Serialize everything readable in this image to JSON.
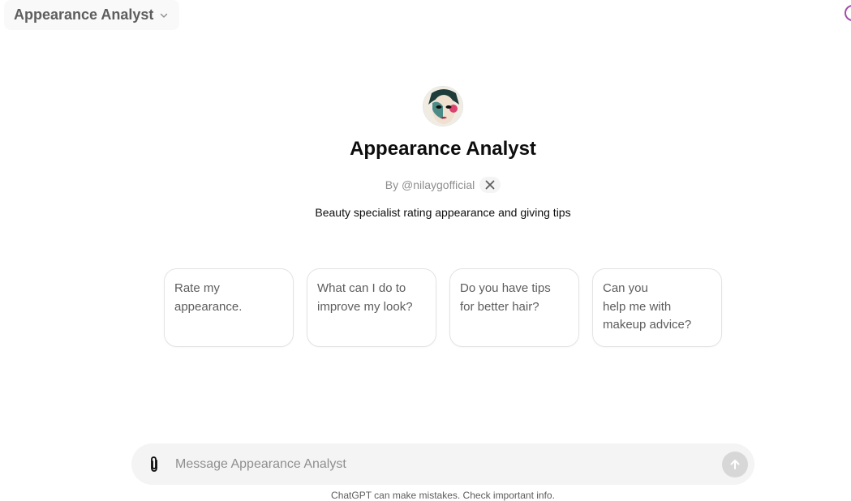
{
  "header": {
    "model_label": "Appearance Analyst",
    "chevron_icon": "chevron-down-icon"
  },
  "gpt": {
    "title": "Appearance Analyst",
    "author": "By @nilaygofficial",
    "social_icon": "x-logo-icon",
    "description": "Beauty specialist rating appearance and giving tips"
  },
  "starters": [
    {
      "lines": [
        "Rate my",
        "appearance."
      ]
    },
    {
      "lines": [
        "What can I do to",
        "improve my look?"
      ]
    },
    {
      "lines": [
        "Do you have tips",
        "for better hair?"
      ]
    },
    {
      "lines": [
        "Can you",
        "help me with",
        "makeup advice?"
      ]
    }
  ],
  "composer": {
    "placeholder": "Message Appearance Analyst",
    "attach_icon": "paperclip-icon",
    "send_icon": "arrow-up-icon"
  },
  "footer": {
    "note": "ChatGPT can make mistakes. Check important info."
  },
  "colors": {
    "card_border": "#e3e3e3",
    "composer_bg": "#f4f4f4",
    "send_disabled": "#d7d7d7",
    "muted_text": "#8e8e8e"
  }
}
